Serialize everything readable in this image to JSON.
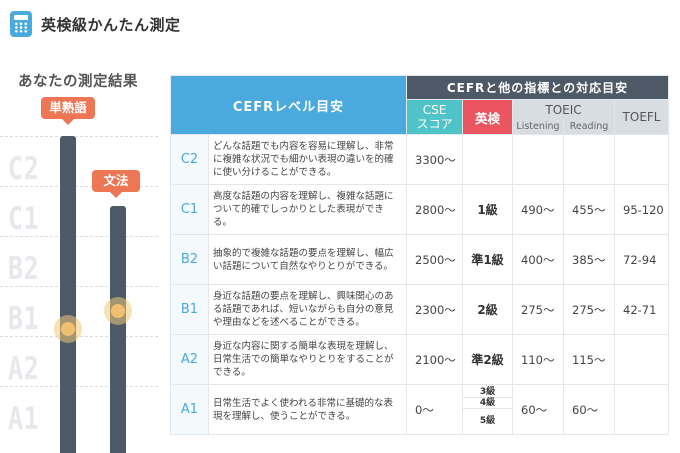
{
  "app": {
    "title": "英検級かんたん測定",
    "icon": "calculator-icon"
  },
  "result": {
    "title": "あなたの測定結果",
    "levels": [
      "C2",
      "C1",
      "B2",
      "B1",
      "A2",
      "A1"
    ],
    "bars": [
      {
        "label": "単熟語",
        "level": "B1"
      },
      {
        "label": "文法",
        "level": "B1"
      }
    ]
  },
  "table": {
    "cefr_header": "CEFRレベル目安",
    "mapping_header": "CEFRと他の指標との対応目安",
    "cse_header": [
      "CSE",
      "スコア"
    ],
    "eiken_header": "英検",
    "toeic_header": "TOEIC",
    "toeic_sub": [
      "Listening",
      "Reading"
    ],
    "toefl_header": "TOEFL",
    "rows": [
      {
        "level": "C2",
        "desc": "どんな話題でも内容を容易に理解し、非常に複雑な状況でも細かい表現の違いを的確に使い分けることができる。",
        "cse": "3300〜",
        "eiken": "",
        "listening": "",
        "reading": "",
        "toefl": ""
      },
      {
        "level": "C1",
        "desc": "高度な話題の内容を理解し、複雑な話題について的確でしっかりとした表現ができる。",
        "cse": "2800〜",
        "eiken": "1級",
        "listening": "490〜",
        "reading": "455〜",
        "toefl": "95-120"
      },
      {
        "level": "B2",
        "desc": "抽象的で複雑な話題の要点を理解し、幅広い話題について自然なやりとりができる。",
        "cse": "2500〜",
        "eiken": "準1級",
        "listening": "400〜",
        "reading": "385〜",
        "toefl": "72-94"
      },
      {
        "level": "B1",
        "desc": "身近な話題の要点を理解し、興味関心のある話題であれば、短いながらも自分の意見や理由などを述べることができる。",
        "cse": "2300〜",
        "eiken": "2級",
        "listening": "275〜",
        "reading": "275〜",
        "toefl": "42-71"
      },
      {
        "level": "A2",
        "desc": "身近な内容に関する簡単な表現を理解し、日常生活での簡単なやりとりをすることができる。",
        "cse": "2100〜",
        "eiken": "準2級",
        "listening": "110〜",
        "reading": "115〜",
        "toefl": ""
      },
      {
        "level": "A1",
        "desc": "日常生活でよく使われる非常に基礎的な表現を理解し、使うことができる。",
        "cse": "0〜",
        "eiken_stack": [
          "3級",
          "4級",
          "5級"
        ],
        "listening": "60〜",
        "reading": "60〜",
        "toefl": ""
      }
    ]
  },
  "colors": {
    "accent": "#4aa9dd",
    "tag": "#ed7655",
    "bar": "#4d5966",
    "cse": "#4fc3c7",
    "eiken": "#ea5560",
    "marker": "#f0c070"
  }
}
